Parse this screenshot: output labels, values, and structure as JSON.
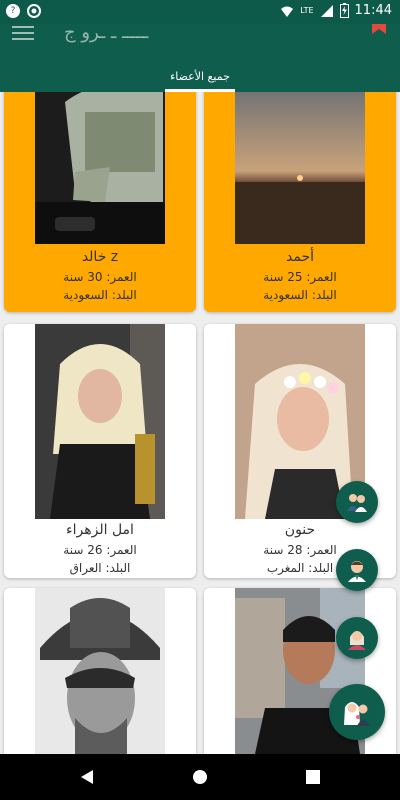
{
  "status_bar": {
    "time": "11:44",
    "network": "LTE",
    "notif_badge": "?"
  },
  "app_bar": {
    "title": "ـــــ ـ ـرو ج"
  },
  "tabs": [
    {
      "label": "جميع الأعضاء",
      "selected": true
    }
  ],
  "members": [
    {
      "name": "أحمد",
      "age": "العمر: 25 سنة",
      "country": "البلد: السعودية",
      "highlighted": true
    },
    {
      "name": "خالد z",
      "age": "العمر: 30 سنة",
      "country": "البلد: السعودية",
      "highlighted": true
    },
    {
      "name": "حنون",
      "age": "العمر: 28 سنة",
      "country": "البلد: المغرب",
      "highlighted": false
    },
    {
      "name": "امل الزهراء",
      "age": "العمر: 26 سنة",
      "country": "البلد: العراق",
      "highlighted": false
    },
    {
      "name": "",
      "age": "",
      "country": "",
      "highlighted": false
    },
    {
      "name": "",
      "age": "",
      "country": "",
      "highlighted": false
    }
  ],
  "fab_buttons": [
    {
      "icon": "couple-icon"
    },
    {
      "icon": "man-icon"
    },
    {
      "icon": "woman-icon"
    },
    {
      "icon": "bride-groom-icon"
    }
  ],
  "colors": {
    "primary": "#0f5e4d",
    "highlight": "#ffa800",
    "card": "#ffffff"
  }
}
